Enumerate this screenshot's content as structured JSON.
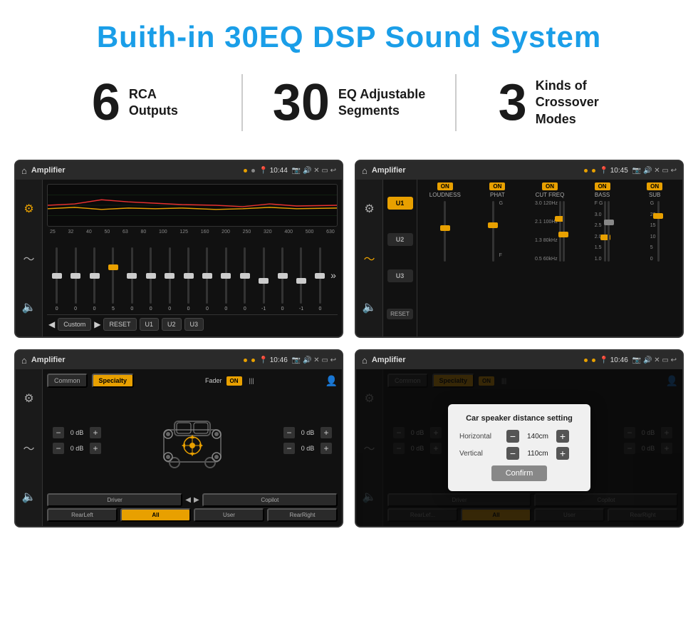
{
  "page": {
    "title": "Buith-in 30EQ DSP Sound System"
  },
  "stats": [
    {
      "number": "6",
      "label": "RCA\nOutputs"
    },
    {
      "number": "30",
      "label": "EQ Adjustable\nSegments"
    },
    {
      "number": "3",
      "label": "Kinds of\nCrossover Modes"
    }
  ],
  "screens": {
    "screen1": {
      "topbar": {
        "title": "Amplifier",
        "time": "10:44",
        "dots": "●  ▶"
      },
      "freqs": [
        "25",
        "32",
        "40",
        "50",
        "63",
        "80",
        "100",
        "125",
        "160",
        "200",
        "250",
        "320",
        "400",
        "500",
        "630"
      ],
      "values": [
        "0",
        "0",
        "0",
        "5",
        "0",
        "0",
        "0",
        "0",
        "0",
        "0",
        "0",
        "-1",
        "0",
        "-1"
      ],
      "buttons": [
        "Custom",
        "RESET",
        "U1",
        "U2",
        "U3"
      ]
    },
    "screen2": {
      "topbar": {
        "title": "Amplifier",
        "time": "10:45"
      },
      "channels": [
        "LOUDNESS",
        "PHAT",
        "CUT FREQ",
        "BASS",
        "SUB"
      ],
      "presets": [
        "U1",
        "U2",
        "U3"
      ]
    },
    "screen3": {
      "topbar": {
        "title": "Amplifier",
        "time": "10:46"
      },
      "tabs": [
        "Common",
        "Specialty"
      ],
      "faderLabel": "Fader",
      "zones": [
        "Driver",
        "Copilot",
        "RearLeft",
        "All",
        "User",
        "RearRight"
      ],
      "dbValues": [
        "0 dB",
        "0 dB",
        "0 dB",
        "0 dB"
      ]
    },
    "screen4": {
      "topbar": {
        "title": "Amplifier",
        "time": "10:46"
      },
      "dialog": {
        "title": "Car speaker distance setting",
        "horizontal_label": "Horizontal",
        "horizontal_value": "140cm",
        "vertical_label": "Vertical",
        "vertical_value": "110cm",
        "confirm_label": "Confirm"
      },
      "dbValues": [
        "0 dB",
        "0 dB"
      ],
      "zones": [
        "Driver",
        "Copilot",
        "RearLef...",
        "All",
        "User",
        "RearRight"
      ]
    }
  },
  "icons": {
    "home": "⌂",
    "location": "📍",
    "volume": "🔊",
    "back": "↩",
    "camera": "📷",
    "close": "✕",
    "menu": "≡",
    "eq": "⚙",
    "wave": "〜",
    "speaker": "🔈",
    "user": "👤",
    "arrow_up": "▲",
    "arrow_down": "▼",
    "arrow_left": "◀",
    "arrow_right": "▶",
    "chevron_double": "»"
  }
}
